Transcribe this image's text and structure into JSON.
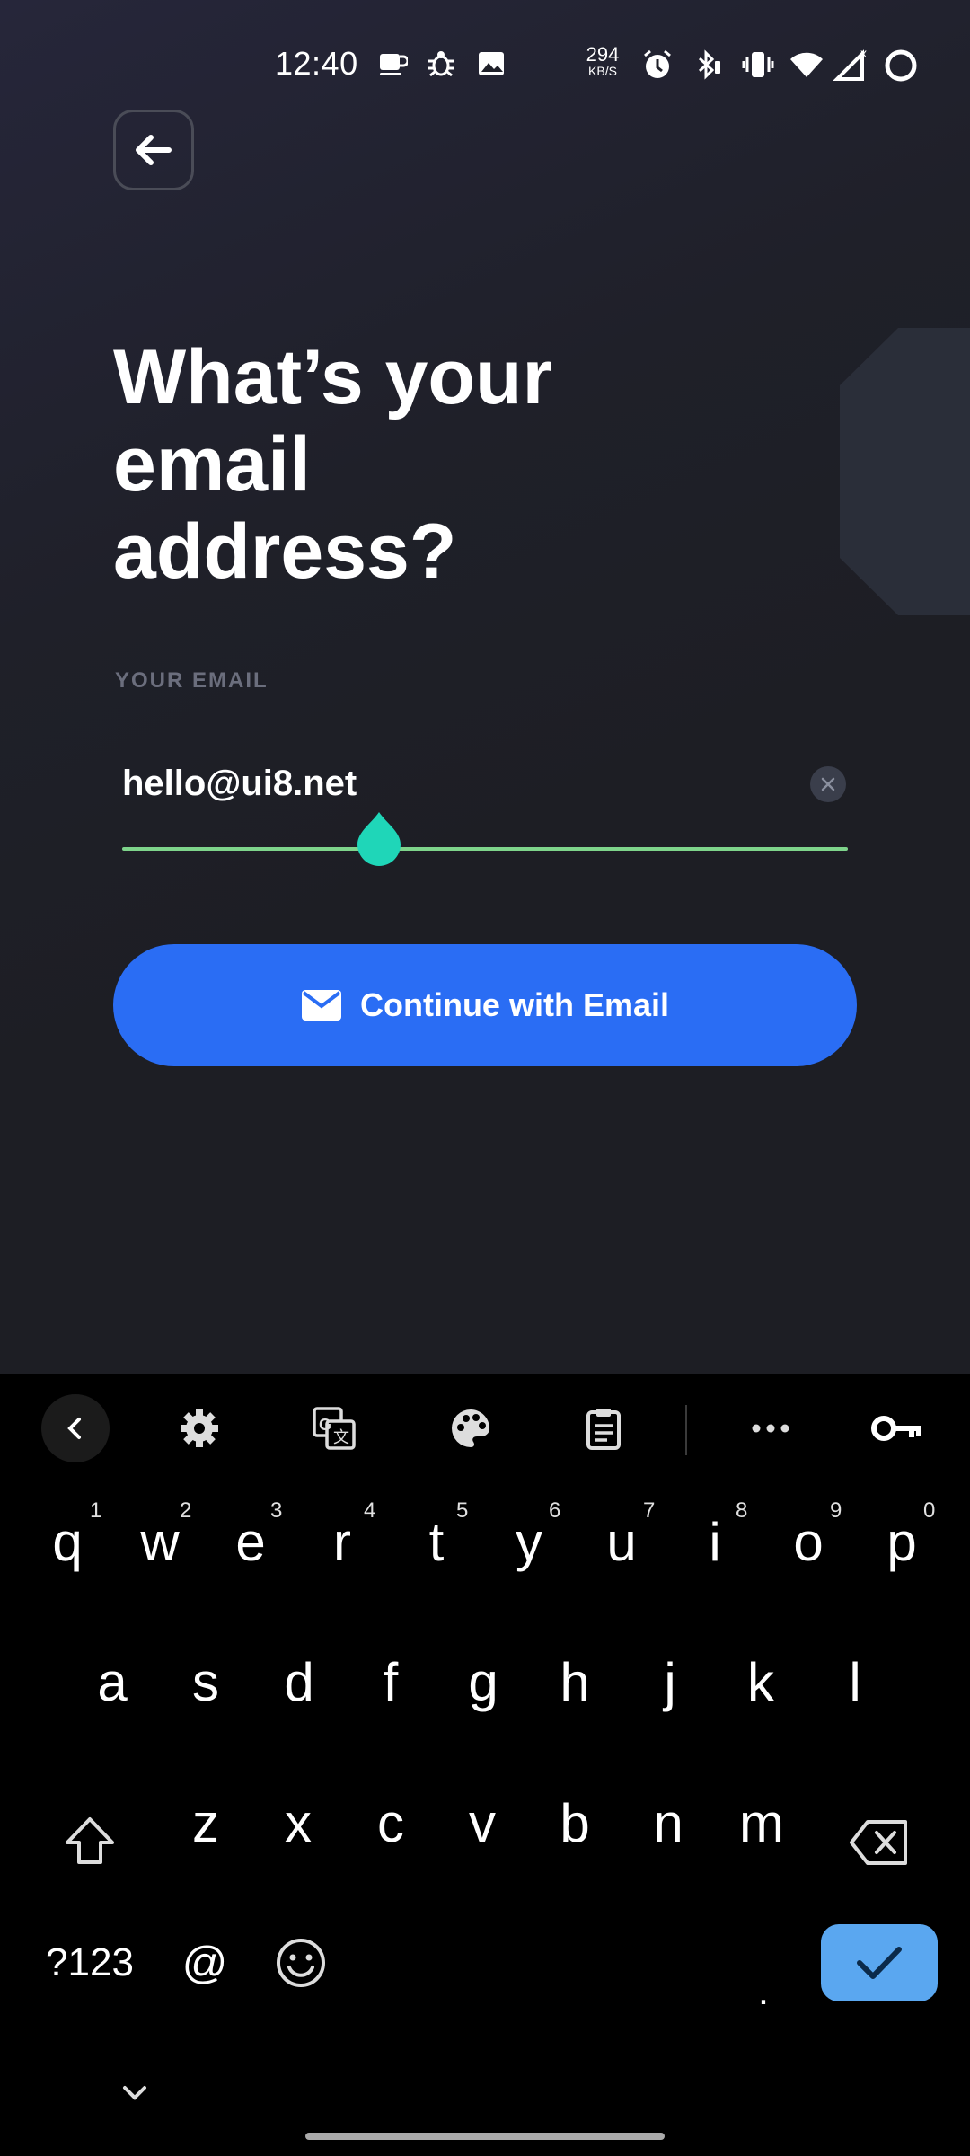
{
  "status_bar": {
    "time": "12:40",
    "net_speed_value": "294",
    "net_speed_unit": "KB/S",
    "icons": [
      "coffee-icon",
      "bug-icon",
      "image-icon",
      "alarm-icon",
      "bluetooth-icon",
      "vibrate-icon",
      "wifi-icon",
      "signal-icon",
      "battery-ring-icon"
    ]
  },
  "header": {
    "back_icon": "arrow-left-icon"
  },
  "main": {
    "title": "What’s your\nemail\naddress?",
    "field_label": "YOUR EMAIL",
    "email_value": "hello@ui8.net",
    "clear_icon": "close-icon",
    "continue_label": "Continue with Email",
    "continue_icon": "mail-icon"
  },
  "colors": {
    "background": "#1d1e24",
    "accent_blue": "#2a6df4",
    "underline_green": "#7ed48b",
    "cursor_teal": "#1fd6b8",
    "enter_key": "#5aa7f0"
  },
  "keyboard": {
    "toolbar_icons": [
      "chevron-left-icon",
      "gear-icon",
      "translate-icon",
      "palette-icon",
      "clipboard-icon",
      "more-icon",
      "key-icon"
    ],
    "row1": [
      {
        "k": "q",
        "h": "1"
      },
      {
        "k": "w",
        "h": "2"
      },
      {
        "k": "e",
        "h": "3"
      },
      {
        "k": "r",
        "h": "4"
      },
      {
        "k": "t",
        "h": "5"
      },
      {
        "k": "y",
        "h": "6"
      },
      {
        "k": "u",
        "h": "7"
      },
      {
        "k": "i",
        "h": "8"
      },
      {
        "k": "o",
        "h": "9"
      },
      {
        "k": "p",
        "h": "0"
      }
    ],
    "row2": [
      "a",
      "s",
      "d",
      "f",
      "g",
      "h",
      "j",
      "k",
      "l"
    ],
    "row3": [
      "z",
      "x",
      "c",
      "v",
      "b",
      "n",
      "m"
    ],
    "symbols_label": "?123",
    "at_label": "@",
    "period_label": ".",
    "bottom_icon": "chevron-down-icon"
  }
}
